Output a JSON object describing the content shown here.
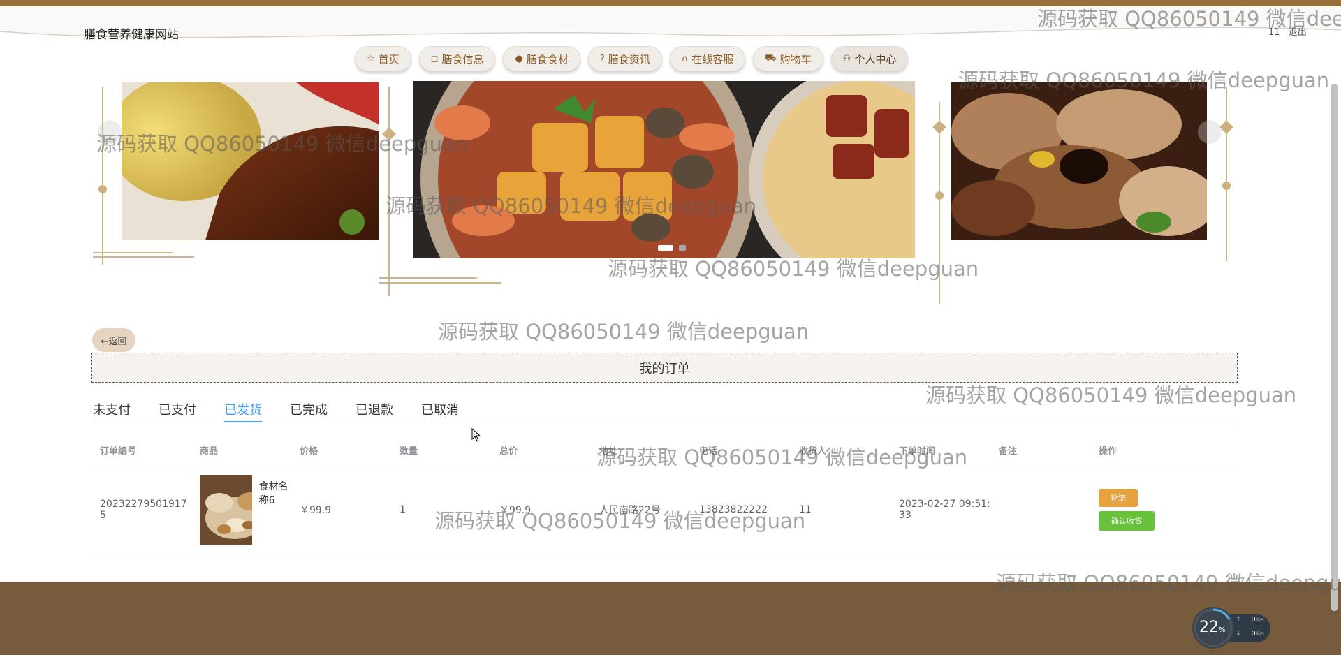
{
  "header": {
    "site_title": "膳食营养健康网站",
    "user": "11",
    "logout": "退出"
  },
  "nav": [
    {
      "icon": "star-icon",
      "glyph": "☆",
      "label": "首页"
    },
    {
      "icon": "bag-icon",
      "glyph": "◻",
      "label": "膳食信息"
    },
    {
      "icon": "info-icon",
      "glyph": "●",
      "label": "膳食食材"
    },
    {
      "icon": "help-icon",
      "glyph": "?",
      "label": "膳食资讯"
    },
    {
      "icon": "headset-icon",
      "glyph": "∩",
      "label": "在线客服"
    },
    {
      "icon": "cart-icon",
      "glyph": "⛟",
      "label": "购物车"
    },
    {
      "icon": "user-icon",
      "glyph": "⚇",
      "label": "个人中心"
    }
  ],
  "back_label": "←返回",
  "section_title": "我的订单",
  "tabs": [
    {
      "label": "未支付"
    },
    {
      "label": "已支付"
    },
    {
      "label": "已发货",
      "active": true
    },
    {
      "label": "已完成"
    },
    {
      "label": "已退款"
    },
    {
      "label": "已取消"
    }
  ],
  "table": {
    "headers": [
      "订单编号",
      "商品",
      "价格",
      "数量",
      "总价",
      "地址",
      "电话",
      "收货人",
      "下单时间",
      "备注",
      "操作"
    ],
    "rows": [
      {
        "order_no": "202322795019175",
        "product_name": "食材名称6",
        "price": "￥99.9",
        "quantity": "1",
        "total": "￥99.9",
        "address": "人民南路22号",
        "phone": "13823822222",
        "receiver": "11",
        "time": "2023-02-27 09:51:33",
        "note": ""
      }
    ],
    "actions": {
      "logistics": "物流",
      "confirm": "确认收货"
    }
  },
  "watermark": "源码获取 QQ86050149 微信deepguan",
  "net_widget": {
    "percent": "22",
    "unit": "%",
    "up": "0",
    "down": "0",
    "rate_unit": "K/s"
  },
  "colors": {
    "accent": "#409eff",
    "brand_brown": "#765b3d",
    "nav_text": "#8a5a22",
    "warning": "#e6a23c",
    "success": "#67c23a"
  }
}
